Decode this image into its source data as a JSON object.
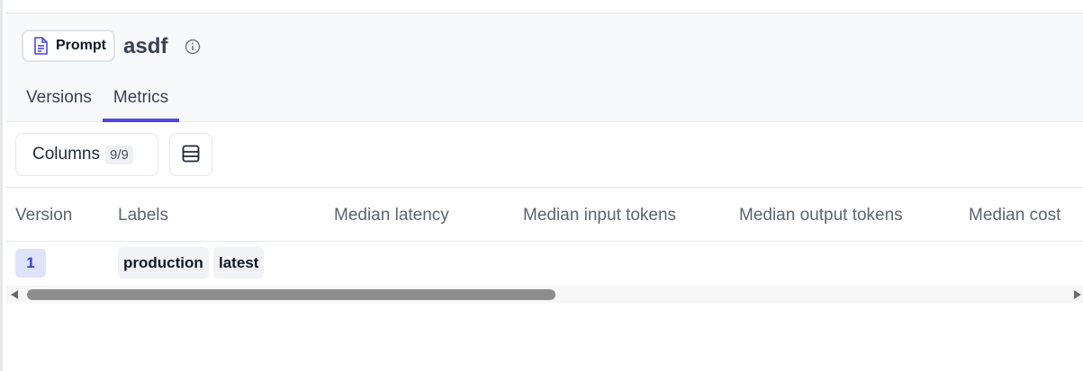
{
  "header": {
    "type_label": "Prompt",
    "title": "asdf",
    "tabs": [
      {
        "label": "Versions",
        "active": false
      },
      {
        "label": "Metrics",
        "active": true
      }
    ],
    "accent_color": "#4f46e5"
  },
  "toolbar": {
    "columns_label": "Columns",
    "columns_count": "9/9"
  },
  "table": {
    "columns": [
      "Version",
      "Labels",
      "Median latency",
      "Median input tokens",
      "Median output tokens",
      "Median cost"
    ],
    "rows": [
      {
        "version": "1",
        "labels": [
          "production",
          "latest"
        ]
      }
    ]
  },
  "icons": {
    "type": "document-icon",
    "info": "info-icon",
    "density": "rows-icon"
  }
}
